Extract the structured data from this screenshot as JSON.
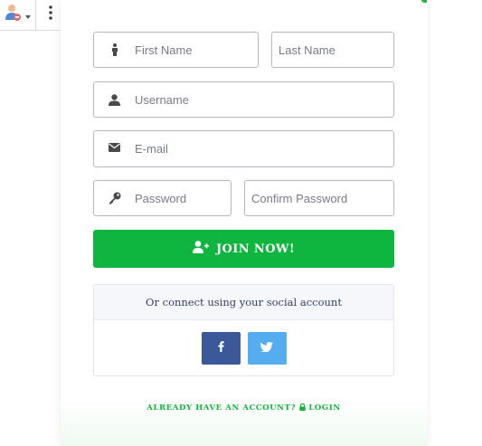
{
  "toolbar": {
    "user_icon": "user-avatar-icon",
    "dropdown_icon": "caret-down-icon",
    "menu_icon": "vertical-dots-icon"
  },
  "form": {
    "first_name": {
      "placeholder": "First Name",
      "icon": "user-standing-icon"
    },
    "last_name": {
      "placeholder": "Last Name"
    },
    "username": {
      "placeholder": "Username",
      "icon": "user-icon"
    },
    "email": {
      "placeholder": "E-mail",
      "icon": "envelope-icon"
    },
    "password": {
      "placeholder": "Password",
      "icon": "key-icon"
    },
    "confirm_password": {
      "placeholder": "Confirm Password"
    }
  },
  "join_button": {
    "label": "JOIN NOW!",
    "icon": "user-plus-icon"
  },
  "social": {
    "heading": "Or connect using your social account",
    "facebook_icon": "facebook-icon",
    "twitter_icon": "twitter-icon"
  },
  "footer": {
    "prompt": "ALREADY HAVE AN ACCOUNT?",
    "login_label": "LOGIN",
    "lock_icon": "lock-icon"
  },
  "colors": {
    "accent_green": "#0eb53e",
    "facebook": "#3b5998",
    "twitter": "#55acee",
    "border": "#b7b7c4"
  }
}
